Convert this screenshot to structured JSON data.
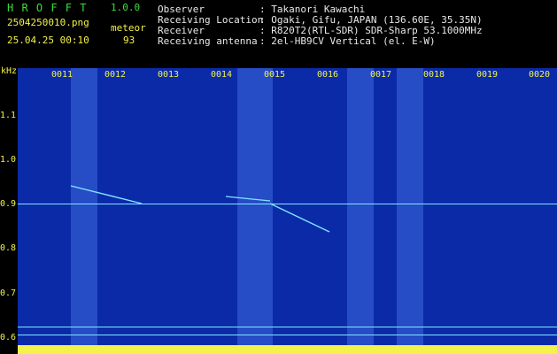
{
  "app": {
    "name": "H R O F F T",
    "version": "1.0.0"
  },
  "file": {
    "name": "2504250010.png",
    "datetime": "25.04.25 00:10"
  },
  "detection": {
    "label": "meteor",
    "count": "93"
  },
  "station": [
    {
      "key": "Observer",
      "value": ": Takanori Kawachi"
    },
    {
      "key": "Receiving Location",
      "value": ": Ogaki, Gifu, JAPAN (136.60E, 35.35N)"
    },
    {
      "key": "Receiver",
      "value": ": R820T2(RTL-SDR) SDR-Sharp 53.1000MHz"
    },
    {
      "key": "Receiving antenna",
      "value": ": 2el-HB9CV Vertical (el. E-W)"
    }
  ],
  "axes": {
    "y_unit": "kHz",
    "y_ticks": [
      "1.1",
      "1.0",
      "0.9",
      "0.8",
      "0.7",
      "0.6"
    ],
    "x_ticks": [
      "0011",
      "0012",
      "0013",
      "0014",
      "0015",
      "0016",
      "0017",
      "0018",
      "0019",
      "0020"
    ]
  },
  "colors": {
    "label": "#f2f24a",
    "title": "#3ddc3d",
    "background": "#0b2aa8",
    "carrier": "#7fe6ff"
  }
}
